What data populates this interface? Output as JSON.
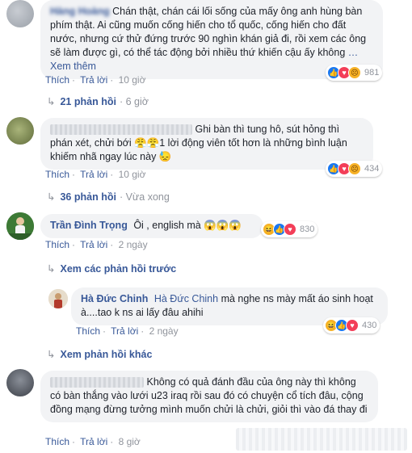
{
  "comments": [
    {
      "author": "Hàng Hoàng",
      "text_start": "Chán thật, chán cái lối sống của mấy ông anh hùng bàn phím thật. Ai cũng muốn cống hiến cho tổ quốc, cống hiến cho đất nước, nhưng cứ thử đứng trước 90 nghìn khán giả đi, rồi xem các ông sẽ làm được gì, có thể tác động bởi nhiều thứ khiến cậu ấy không",
      "see_more": "… Xem thêm",
      "like": "Thích",
      "reply": "Trả lời",
      "time": "10 giờ",
      "reactions": [
        "like",
        "love",
        "sad"
      ],
      "reaction_count": "981",
      "replies_label": "21 phản hồi",
      "replies_time": "· 6 giờ"
    },
    {
      "text": "Ghi bàn thì tung hô, sút hỏng thì phán xét, chửi bới 😤😤1 lời động viên tốt hơn là những bình luận khiếm nhã ngay lúc này 😓",
      "like": "Thích",
      "reply": "Trả lời",
      "time": "10 giờ",
      "reactions": [
        "like",
        "love",
        "sad"
      ],
      "reaction_count": "434",
      "replies_label": "36 phản hồi",
      "replies_time": "· Vừa xong"
    },
    {
      "author": "Trần Đình Trọng",
      "text": "Ôi , english mà 😱😱😱",
      "like": "Thích",
      "reply": "Trả lời",
      "time": "2 ngày",
      "reactions": [
        "haha",
        "like",
        "love"
      ],
      "reaction_count": "830",
      "prev_replies": "Xem các phản hồi trước"
    },
    {
      "author": "Hà Đức Chinh",
      "tagged": "Hà Đức Chinh",
      "text": "mà nghe ns mày mất áo sinh hoạt à....tao k ns ai lấy đâu ahihi",
      "like": "Thích",
      "reply": "Trả lời",
      "time": "2 ngày",
      "reactions": [
        "haha",
        "like",
        "love"
      ],
      "reaction_count": "430",
      "more_replies": "Xem phản hồi khác"
    },
    {
      "text": "Không có quả đánh đầu của ông này thì không có bàn thắng vào lưới u23 iraq rồi sau đó có chuyện cổ tích đâu, cộng đồng mạng đừng tưởng mình muốn chửi là chửi, giỏi thì vào đá thay đi",
      "like": "Thích",
      "reply": "Trả lời",
      "time": "8 giờ"
    }
  ],
  "icons": {
    "reply_arrow": "reply-arrow-icon"
  },
  "colors": {
    "link": "#385898",
    "bubble": "#f2f3f5",
    "meta": "#90949c",
    "like": "#1877f2",
    "love": "#f33e58",
    "sad": "#f7b125"
  }
}
